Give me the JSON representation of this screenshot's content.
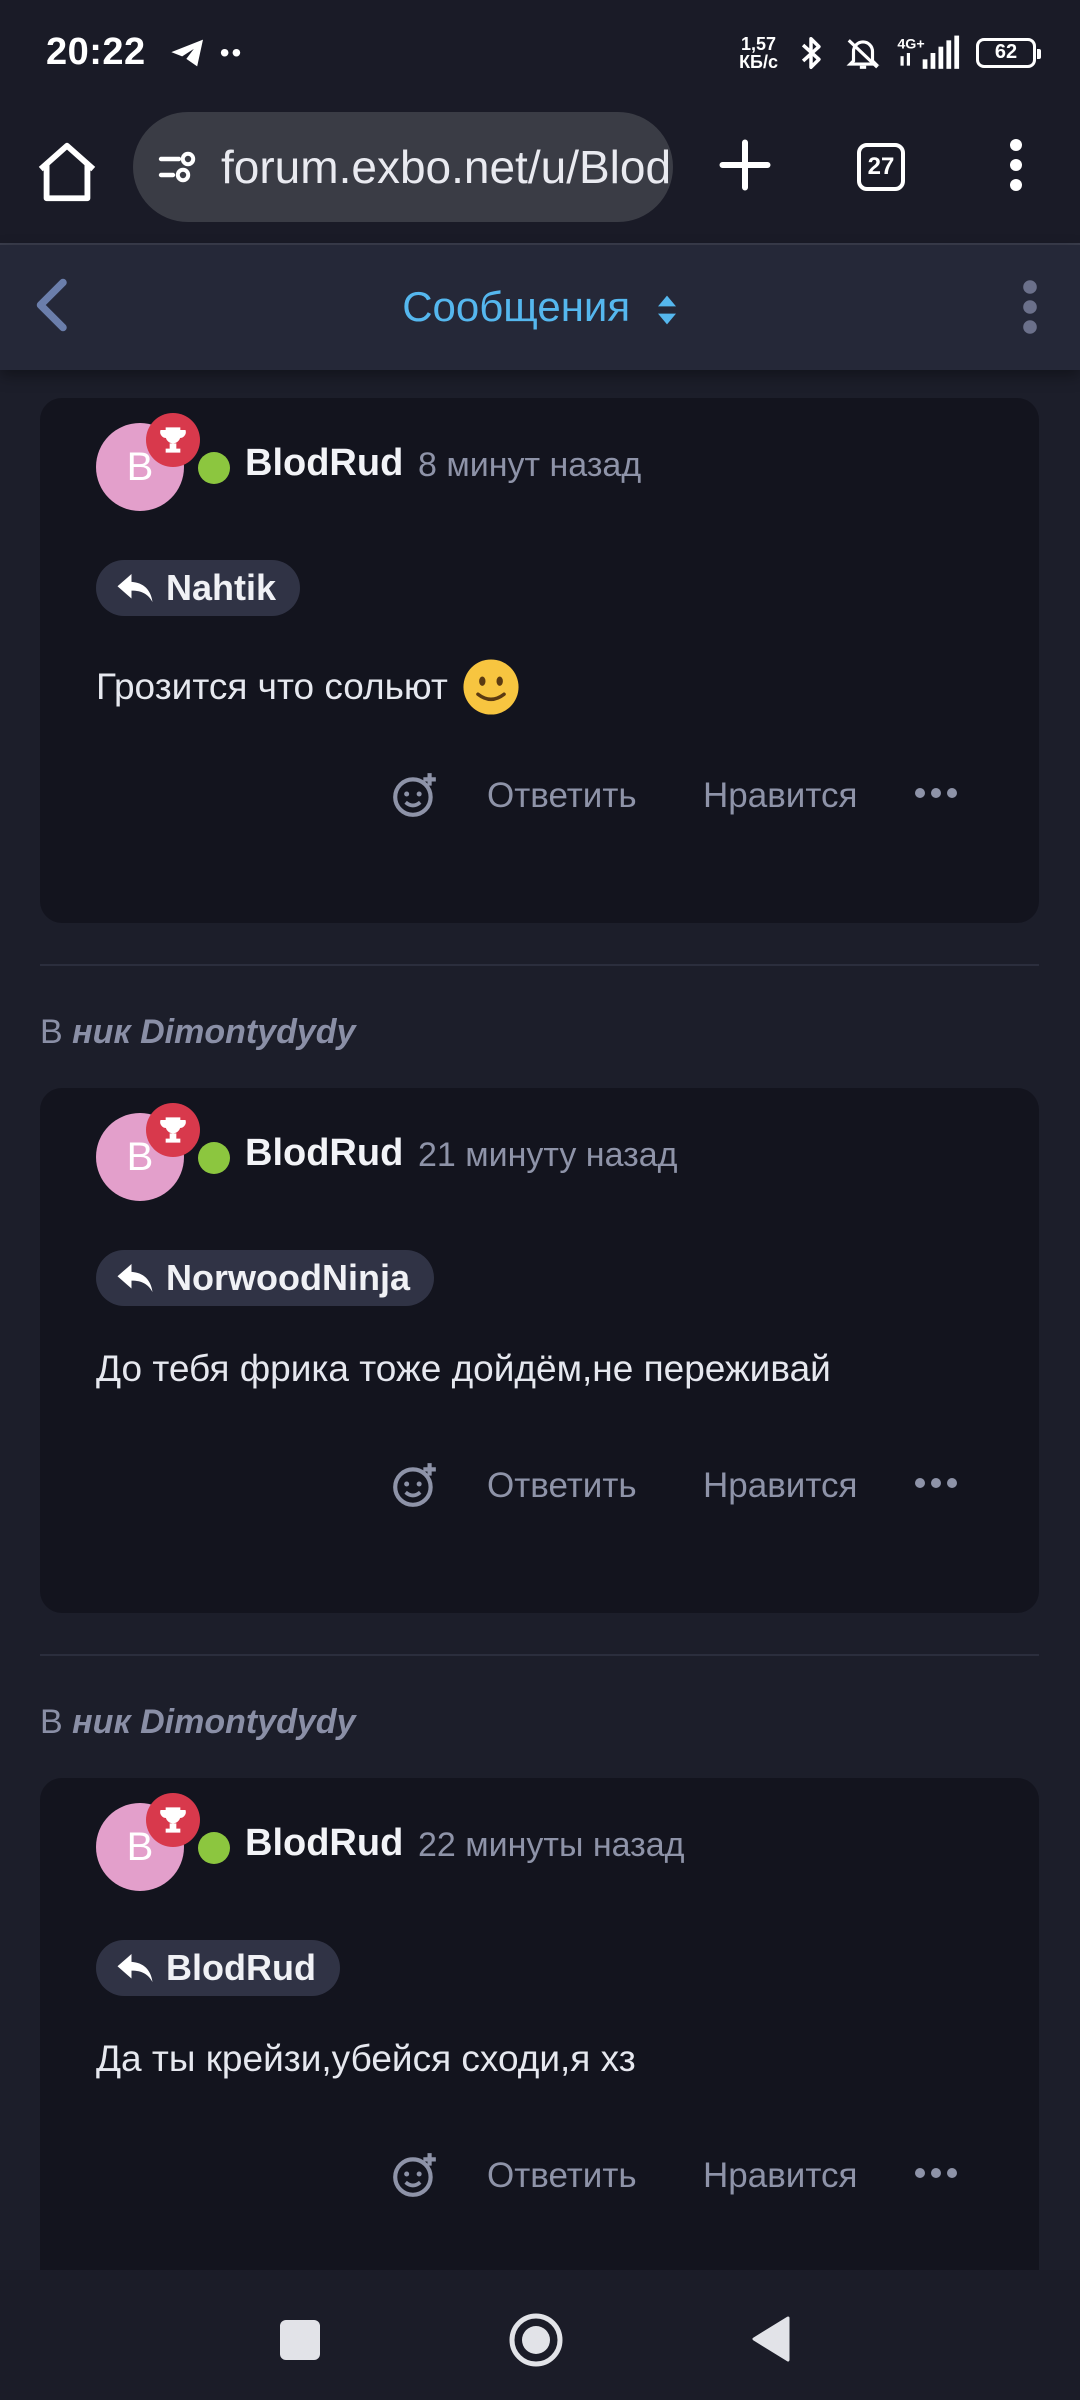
{
  "status_bar": {
    "time": "20:22",
    "dots": "••",
    "net_speed_value": "1,57",
    "net_speed_unit": "КБ/с",
    "network": "4G+",
    "battery": "62"
  },
  "browser": {
    "url": "forum.exbo.net/u/BlodRud",
    "tab_count": "27"
  },
  "header": {
    "title": "Сообщения"
  },
  "posts": [
    {
      "avatar_letter": "B",
      "author": "BlodRud",
      "time": "8 минут назад",
      "reply_to": "Nahtik",
      "body": "Грозится что сольют",
      "actions": {
        "reply": "Ответить",
        "like": "Нравится"
      }
    },
    {
      "context_prefix": "В",
      "context_title": "ник Dimontydydy",
      "avatar_letter": "B",
      "author": "BlodRud",
      "time": "21 минуту назад",
      "reply_to": "NorwoodNinja",
      "body": "До тебя фрика тоже дойдём,не переживай",
      "actions": {
        "reply": "Ответить",
        "like": "Нравится"
      }
    },
    {
      "context_prefix": "В",
      "context_title": "ник Dimontydydy",
      "avatar_letter": "B",
      "author": "BlodRud",
      "time": "22 минуты назад",
      "reply_to": "BlodRud",
      "body": "Да ты крейзи,убейся сходи,я хз",
      "actions": {
        "reply": "Ответить",
        "like": "Нравится"
      }
    }
  ],
  "colors": {
    "accent": "#55b7ee",
    "online": "#8cc63f",
    "badge": "#d8394c",
    "avatar": "#e39fcb"
  }
}
